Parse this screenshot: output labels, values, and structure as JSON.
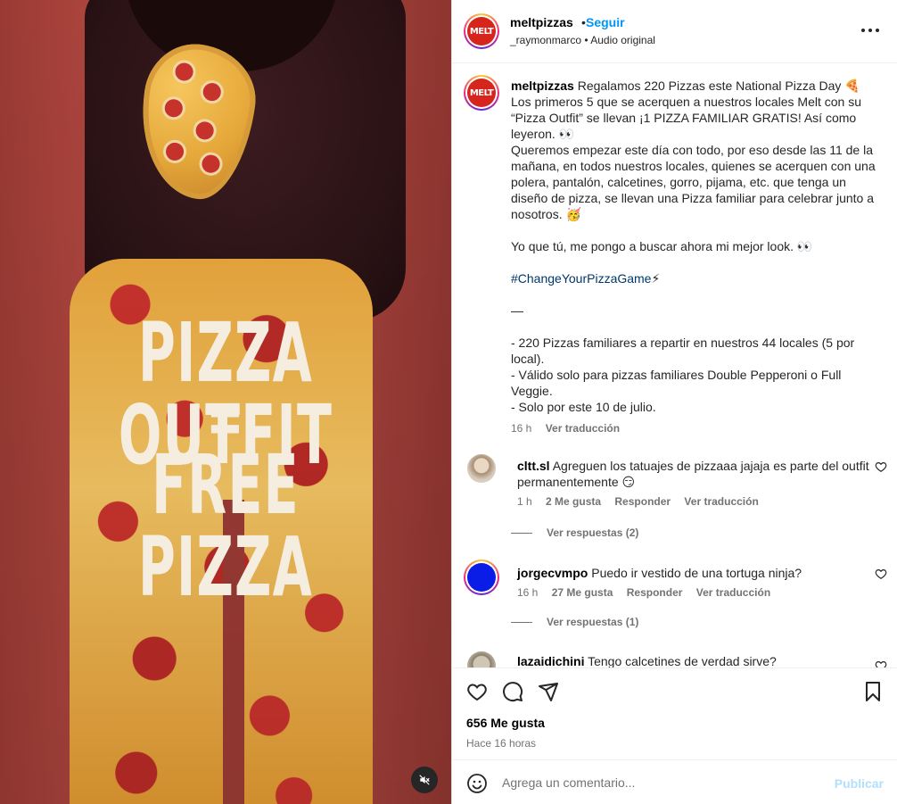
{
  "media": {
    "line1": "PIZZA OUTFIT",
    "line2": "=",
    "line3": "FREE PIZZA"
  },
  "header": {
    "logo_text": "MELT",
    "username": "meltpizzas",
    "dot": "•",
    "follow": "Seguir",
    "audio": "_raymonmarco • Audio original"
  },
  "caption": {
    "username": "meltpizzas",
    "intro": " Regalamos 220 Pizzas este National Pizza Day 🍕\nLos primeros 5 que se acerquen a nuestros locales Melt con su “Pizza Outfit” se llevan ¡1 PIZZA FAMILIAR GRATIS! Así como leyeron. 👀\nQueremos empezar este día con todo, por eso desde las 11 de la mañana, en todos nuestros locales, quienes se acerquen con una polera, pantalón, calcetines, gorro, pijama, etc. que tenga un diseño de pizza, se llevan una Pizza familiar para celebrar junto a nosotros. 🥳\n\nYo que tú, me pongo a buscar ahora mi mejor look. 👀\n\n",
    "hashtag": "#ChangeYourPizzaGame",
    "after_hashtag": "⚡\n\n—\n\n- 220 Pizzas familiares a repartir en nuestros 44 locales (5 por local).\n- Válido solo para pizzas familiares Double Pepperoni o Full Veggie.\n- Solo por este 10 de julio.",
    "time": "16 h",
    "translate": "Ver traducción"
  },
  "comments": [
    {
      "username": "cltt.sl",
      "text": " Agreguen los tatuajes de pizzaaa jajaja es parte del outfit permanentemente 😏",
      "time": "1 h",
      "likes": "2 Me gusta",
      "reply": "Responder",
      "translate": "Ver traducción",
      "replies": "Ver respuestas (2)"
    },
    {
      "username": "jorgecvmpo",
      "text": " Puedo ir vestido de una tortuga ninja?",
      "time": "16 h",
      "likes": "27 Me gusta",
      "reply": "Responder",
      "translate": "Ver traducción",
      "replies": "Ver respuestas (1)"
    },
    {
      "username": "lazaidichini",
      "text": " Tengo calcetines de verdad sirve?"
    }
  ],
  "footer": {
    "likes": "656 Me gusta",
    "time": "Hace 16 horas",
    "comment_placeholder": "Agrega un comentario...",
    "publish": "Publicar"
  }
}
